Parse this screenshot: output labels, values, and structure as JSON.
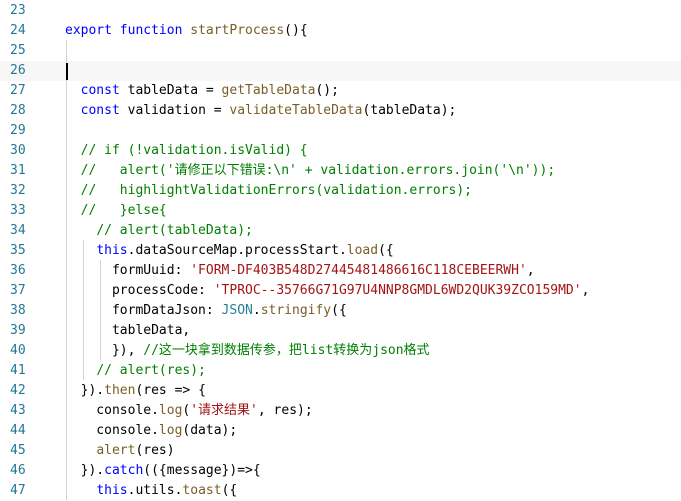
{
  "editor": {
    "lines": [
      {
        "num": "23",
        "tokens": []
      },
      {
        "num": "24",
        "tokens": [
          [
            "kw",
            "export"
          ],
          [
            "pl",
            " "
          ],
          [
            "kw",
            "function"
          ],
          [
            "pl",
            " "
          ],
          [
            "fn",
            "startProcess"
          ],
          [
            "pl",
            "(){"
          ]
        ]
      },
      {
        "num": "25",
        "tokens": []
      },
      {
        "num": "26",
        "tokens": [],
        "current": true
      },
      {
        "num": "27",
        "tokens": [
          [
            "pl",
            "  "
          ],
          [
            "kw",
            "const"
          ],
          [
            "pl",
            " tableData = "
          ],
          [
            "fn",
            "getTableData"
          ],
          [
            "pl",
            "();"
          ]
        ]
      },
      {
        "num": "28",
        "tokens": [
          [
            "pl",
            "  "
          ],
          [
            "kw",
            "const"
          ],
          [
            "pl",
            " validation = "
          ],
          [
            "fn",
            "validateTableData"
          ],
          [
            "pl",
            "(tableData);"
          ]
        ]
      },
      {
        "num": "29",
        "tokens": []
      },
      {
        "num": "30",
        "tokens": [
          [
            "pl",
            "  "
          ],
          [
            "cmt",
            "// if (!validation.isValid) {"
          ]
        ]
      },
      {
        "num": "31",
        "tokens": [
          [
            "pl",
            "  "
          ],
          [
            "cmt",
            "//   alert('请修正以下错误:\\n' + validation.errors.join('\\n'));"
          ]
        ]
      },
      {
        "num": "32",
        "tokens": [
          [
            "pl",
            "  "
          ],
          [
            "cmt",
            "//   highlightValidationErrors(validation.errors);"
          ]
        ]
      },
      {
        "num": "33",
        "tokens": [
          [
            "pl",
            "  "
          ],
          [
            "cmt",
            "//   }else{"
          ]
        ]
      },
      {
        "num": "34",
        "tokens": [
          [
            "pl",
            "    "
          ],
          [
            "cmt",
            "// alert(tableData);"
          ]
        ]
      },
      {
        "num": "35",
        "tokens": [
          [
            "pl",
            "    "
          ],
          [
            "kw",
            "this"
          ],
          [
            "pl",
            ".dataSourceMap.processStart."
          ],
          [
            "fn",
            "load"
          ],
          [
            "pl",
            "({"
          ]
        ]
      },
      {
        "num": "36",
        "tokens": [
          [
            "pl",
            "      formUuid: "
          ],
          [
            "str",
            "'FORM-DF403B548D27445481486616C118CEBEERWH'"
          ],
          [
            "pl",
            ","
          ]
        ]
      },
      {
        "num": "37",
        "tokens": [
          [
            "pl",
            "      processCode: "
          ],
          [
            "str",
            "'TPROC--35766G71G97U4NNP8GMDL6WD2QUK39ZCO159MD'"
          ],
          [
            "pl",
            ","
          ]
        ]
      },
      {
        "num": "38",
        "tokens": [
          [
            "pl",
            "      formDataJson: "
          ],
          [
            "ty",
            "JSON"
          ],
          [
            "pl",
            "."
          ],
          [
            "fn",
            "stringify"
          ],
          [
            "pl",
            "({"
          ]
        ]
      },
      {
        "num": "39",
        "tokens": [
          [
            "pl",
            "      tableData,"
          ]
        ]
      },
      {
        "num": "40",
        "tokens": [
          [
            "pl",
            "      }), "
          ],
          [
            "cmt",
            "//这一块拿到数据传参，把list转换为json格式"
          ]
        ]
      },
      {
        "num": "41",
        "tokens": [
          [
            "pl",
            "    "
          ],
          [
            "cmt",
            "// alert(res);"
          ]
        ]
      },
      {
        "num": "42",
        "tokens": [
          [
            "pl",
            "  })."
          ],
          [
            "fn",
            "then"
          ],
          [
            "pl",
            "(res => {"
          ]
        ]
      },
      {
        "num": "43",
        "tokens": [
          [
            "pl",
            "    console."
          ],
          [
            "fn",
            "log"
          ],
          [
            "pl",
            "("
          ],
          [
            "str",
            "'请求结果'"
          ],
          [
            "pl",
            ", res);"
          ]
        ]
      },
      {
        "num": "44",
        "tokens": [
          [
            "pl",
            "    console."
          ],
          [
            "fn",
            "log"
          ],
          [
            "pl",
            "(data);"
          ]
        ]
      },
      {
        "num": "45",
        "tokens": [
          [
            "pl",
            "    "
          ],
          [
            "fn",
            "alert"
          ],
          [
            "pl",
            "(res)"
          ]
        ]
      },
      {
        "num": "46",
        "tokens": [
          [
            "pl",
            "  })."
          ],
          [
            "kw",
            "catch"
          ],
          [
            "pl",
            "(({message})=>{"
          ]
        ]
      },
      {
        "num": "47",
        "tokens": [
          [
            "pl",
            "    "
          ],
          [
            "kw",
            "this"
          ],
          [
            "pl",
            ".utils."
          ],
          [
            "fn",
            "toast"
          ],
          [
            "pl",
            "({"
          ]
        ]
      }
    ]
  },
  "colors": {
    "line_number": "#237893",
    "keyword": "#0000ff",
    "function": "#795e26",
    "string": "#a31515",
    "comment": "#008000",
    "type": "#267f99"
  }
}
